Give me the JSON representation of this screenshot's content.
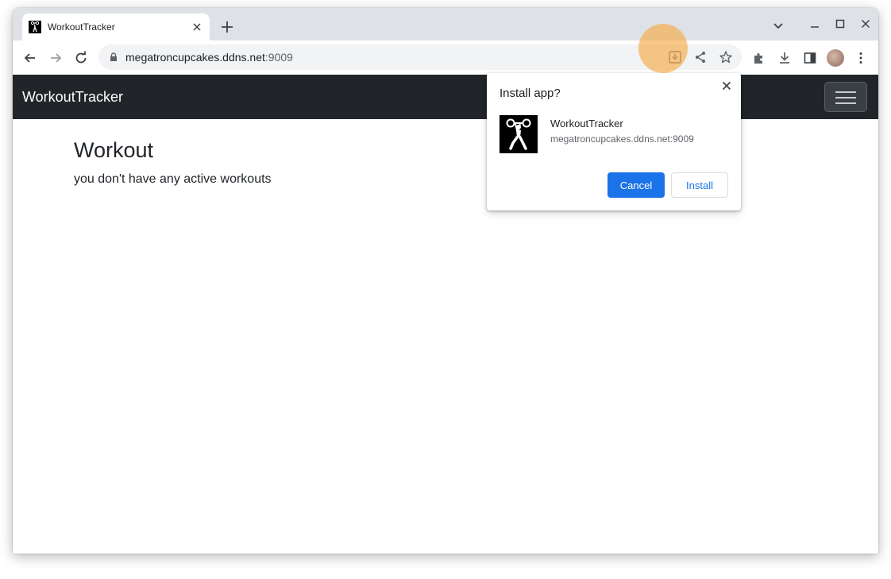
{
  "browser": {
    "tab_title": "WorkoutTracker",
    "url_host": "megatroncupcakes.ddns.net",
    "url_port": ":9009"
  },
  "app": {
    "brand": "WorkoutTracker",
    "page_title": "Workout",
    "empty_message": "you don't have any active workouts"
  },
  "install_dialog": {
    "title": "Install app?",
    "app_name": "WorkoutTracker",
    "app_origin": "megatroncupcakes.ddns.net:9009",
    "cancel_label": "Cancel",
    "install_label": "Install"
  },
  "colors": {
    "accent": "#1a73e8",
    "navbar": "#212529",
    "highlight": "#f5aa46"
  },
  "icons": {
    "tab_favicon": "weightlifter-icon",
    "install_app": "install-app-icon",
    "share": "share-icon",
    "bookmark": "star-icon",
    "extensions": "puzzle-icon",
    "downloads": "download-icon",
    "side_panel": "side-panel-icon",
    "menu": "kebab-menu-icon"
  }
}
